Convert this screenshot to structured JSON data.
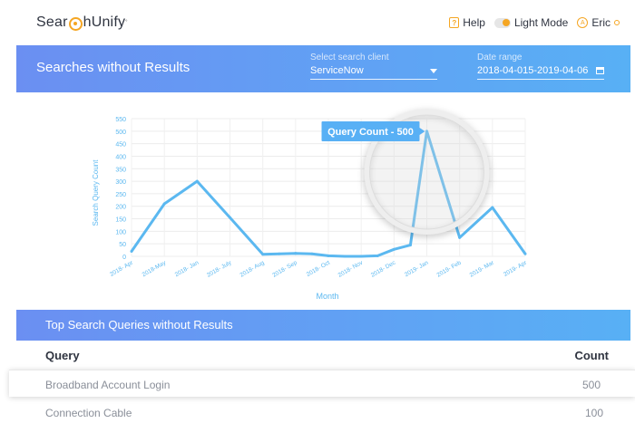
{
  "brand": {
    "name_left": "Sear",
    "name_right": "hUnify",
    "tm": "°"
  },
  "nav": {
    "help_label": "Help",
    "mode_label": "Light Mode",
    "user_label": "Eric",
    "user_initial": "A"
  },
  "header": {
    "title": "Searches without Results",
    "client_label": "Select search client",
    "client_value": "ServiceNow",
    "date_label": "Date range",
    "date_value": "2018-04-015-2019-04-06"
  },
  "chart_data": {
    "type": "line",
    "ylabel": "Search Query Count",
    "xlabel": "Month",
    "ylim": [
      0,
      550
    ],
    "yticks": [
      0,
      50,
      100,
      150,
      200,
      250,
      300,
      350,
      400,
      450,
      500,
      550
    ],
    "categories": [
      "2018- Apr",
      "2018-May",
      "2018- Jan",
      "2018- July",
      "2018- Aug",
      "2018- Sep",
      "2018- Oct",
      "2018- Nov",
      "2018- Dec",
      "2019- Jan",
      "2019- Feb",
      "2019- Mar",
      "2019- Apr"
    ],
    "x": [
      0,
      1,
      2,
      3,
      4,
      4.5,
      5,
      5.5,
      6,
      6.5,
      7,
      7.5,
      8,
      8.5,
      9,
      10,
      11,
      12
    ],
    "values": [
      20,
      210,
      300,
      155,
      8,
      10,
      12,
      10,
      2,
      0,
      0,
      2,
      28,
      45,
      500,
      75,
      195,
      10
    ],
    "tooltip": "Query Count - 500",
    "color": "#5bb8f0"
  },
  "table": {
    "title": "Top Search Queries without Results",
    "col_query": "Query",
    "col_count": "Count",
    "rows": [
      {
        "query": "Broadband Account Login",
        "count": "500"
      },
      {
        "query": "Connection Cable",
        "count": "100"
      }
    ]
  }
}
